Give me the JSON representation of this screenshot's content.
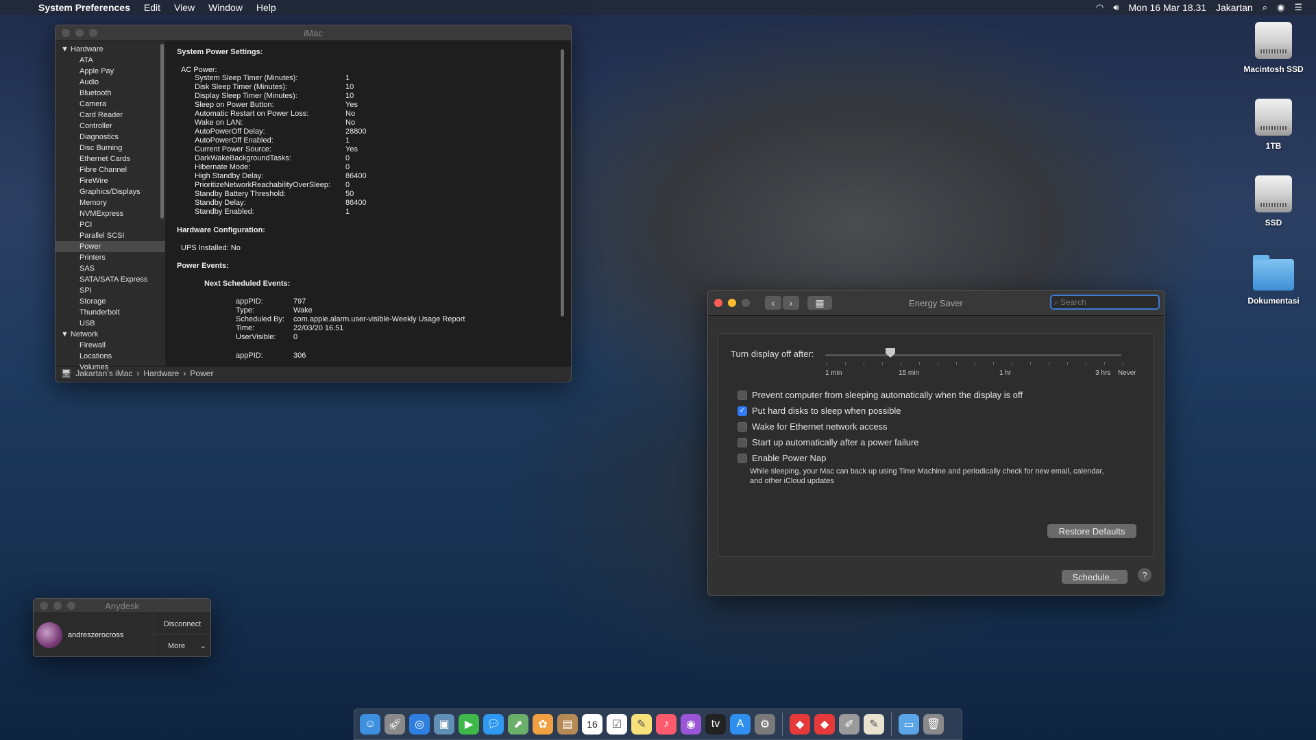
{
  "menubar": {
    "app": "System Preferences",
    "menus": [
      "Edit",
      "View",
      "Window",
      "Help"
    ],
    "datetime": "Mon 16 Mar  18.31",
    "user": "Jakartan"
  },
  "imac": {
    "title": "iMac",
    "sidebar": {
      "hardware_group": "Hardware",
      "hardware_items": [
        "ATA",
        "Apple Pay",
        "Audio",
        "Bluetooth",
        "Camera",
        "Card Reader",
        "Controller",
        "Diagnostics",
        "Disc Burning",
        "Ethernet Cards",
        "Fibre Channel",
        "FireWire",
        "Graphics/Displays",
        "Memory",
        "NVMExpress",
        "PCI",
        "Parallel SCSI",
        "Power",
        "Printers",
        "SAS",
        "SATA/SATA Express",
        "SPI",
        "Storage",
        "Thunderbolt",
        "USB"
      ],
      "network_group": "Network",
      "network_items": [
        "Firewall",
        "Locations",
        "Volumes"
      ]
    },
    "detail": {
      "system_power_settings": "System Power Settings:",
      "ac_power": "AC Power:",
      "settings": [
        [
          "System Sleep Timer (Minutes):",
          "1"
        ],
        [
          "Disk Sleep Timer (Minutes):",
          "10"
        ],
        [
          "Display Sleep Timer (Minutes):",
          "10"
        ],
        [
          "Sleep on Power Button:",
          "Yes"
        ],
        [
          "Automatic Restart on Power Loss:",
          "No"
        ],
        [
          "Wake on LAN:",
          "No"
        ],
        [
          "AutoPowerOff Delay:",
          "28800"
        ],
        [
          "AutoPowerOff Enabled:",
          "1"
        ],
        [
          "Current Power Source:",
          "Yes"
        ],
        [
          "DarkWakeBackgroundTasks:",
          "0"
        ],
        [
          "Hibernate Mode:",
          "0"
        ],
        [
          "High Standby Delay:",
          "86400"
        ],
        [
          "PrioritizeNetworkReachabilityOverSleep:",
          "0"
        ],
        [
          "Standby Battery Threshold:",
          "50"
        ],
        [
          "Standby Delay:",
          "86400"
        ],
        [
          "Standby Enabled:",
          "1"
        ]
      ],
      "hardware_configuration": "Hardware Configuration:",
      "ups_installed": "UPS Installed:  No",
      "power_events": "Power Events:",
      "next_scheduled_events": "Next Scheduled Events:",
      "event": [
        [
          "appPID:",
          "797"
        ],
        [
          "Type:",
          "Wake"
        ],
        [
          "Scheduled By:",
          "com.apple.alarm.user-visible-Weekly Usage Report"
        ],
        [
          "Time:",
          "22/03/20 16.51"
        ],
        [
          "UserVisible:",
          "0"
        ]
      ],
      "event2": [
        [
          "appPID:",
          "306"
        ]
      ]
    },
    "path": [
      "Jakartan’s iMac",
      "Hardware",
      "Power"
    ]
  },
  "energy": {
    "title": "Energy Saver",
    "search_placeholder": "Search",
    "slider_label": "Turn display off after:",
    "slider_value_minutes": 10,
    "tick_labels": [
      "1 min",
      "15 min",
      "1 hr",
      "3 hrs",
      "Never"
    ],
    "options": [
      {
        "label": "Prevent computer from sleeping automatically when the display is off",
        "checked": false
      },
      {
        "label": "Put hard disks to sleep when possible",
        "checked": true
      },
      {
        "label": "Wake for Ethernet network access",
        "checked": false
      },
      {
        "label": "Start up automatically after a power failure",
        "checked": false
      },
      {
        "label": "Enable Power Nap",
        "checked": false
      }
    ],
    "power_nap_note": "While sleeping, your Mac can back up using Time Machine and periodically check for new email, calendar, and other iCloud updates",
    "restore_defaults": "Restore Defaults",
    "schedule": "Schedule...",
    "help": "?"
  },
  "anydesk": {
    "title": "Anydesk",
    "user": "andreszerocross",
    "disconnect": "Disconnect",
    "more": "More"
  },
  "desktop_icons": [
    "Macintosh SSD",
    "1TB",
    "SSD",
    "Dokumentasi"
  ],
  "dock_icons": [
    "finder-icon",
    "launchpad-icon",
    "safari-icon",
    "preview-icon",
    "facetime-icon",
    "messages-icon",
    "maps-icon",
    "photos-icon",
    "contacts-icon",
    "calendar-icon",
    "reminders-icon",
    "notes-icon",
    "music-icon",
    "podcasts-icon",
    "tv-icon",
    "app-store-icon",
    "system-preferences-icon",
    "anydesk-icon",
    "anydesk-2-icon",
    "script-editor-icon",
    "textedit-icon",
    "downloads-folder-icon",
    "trash-icon"
  ],
  "dock_calendar_day": "16"
}
